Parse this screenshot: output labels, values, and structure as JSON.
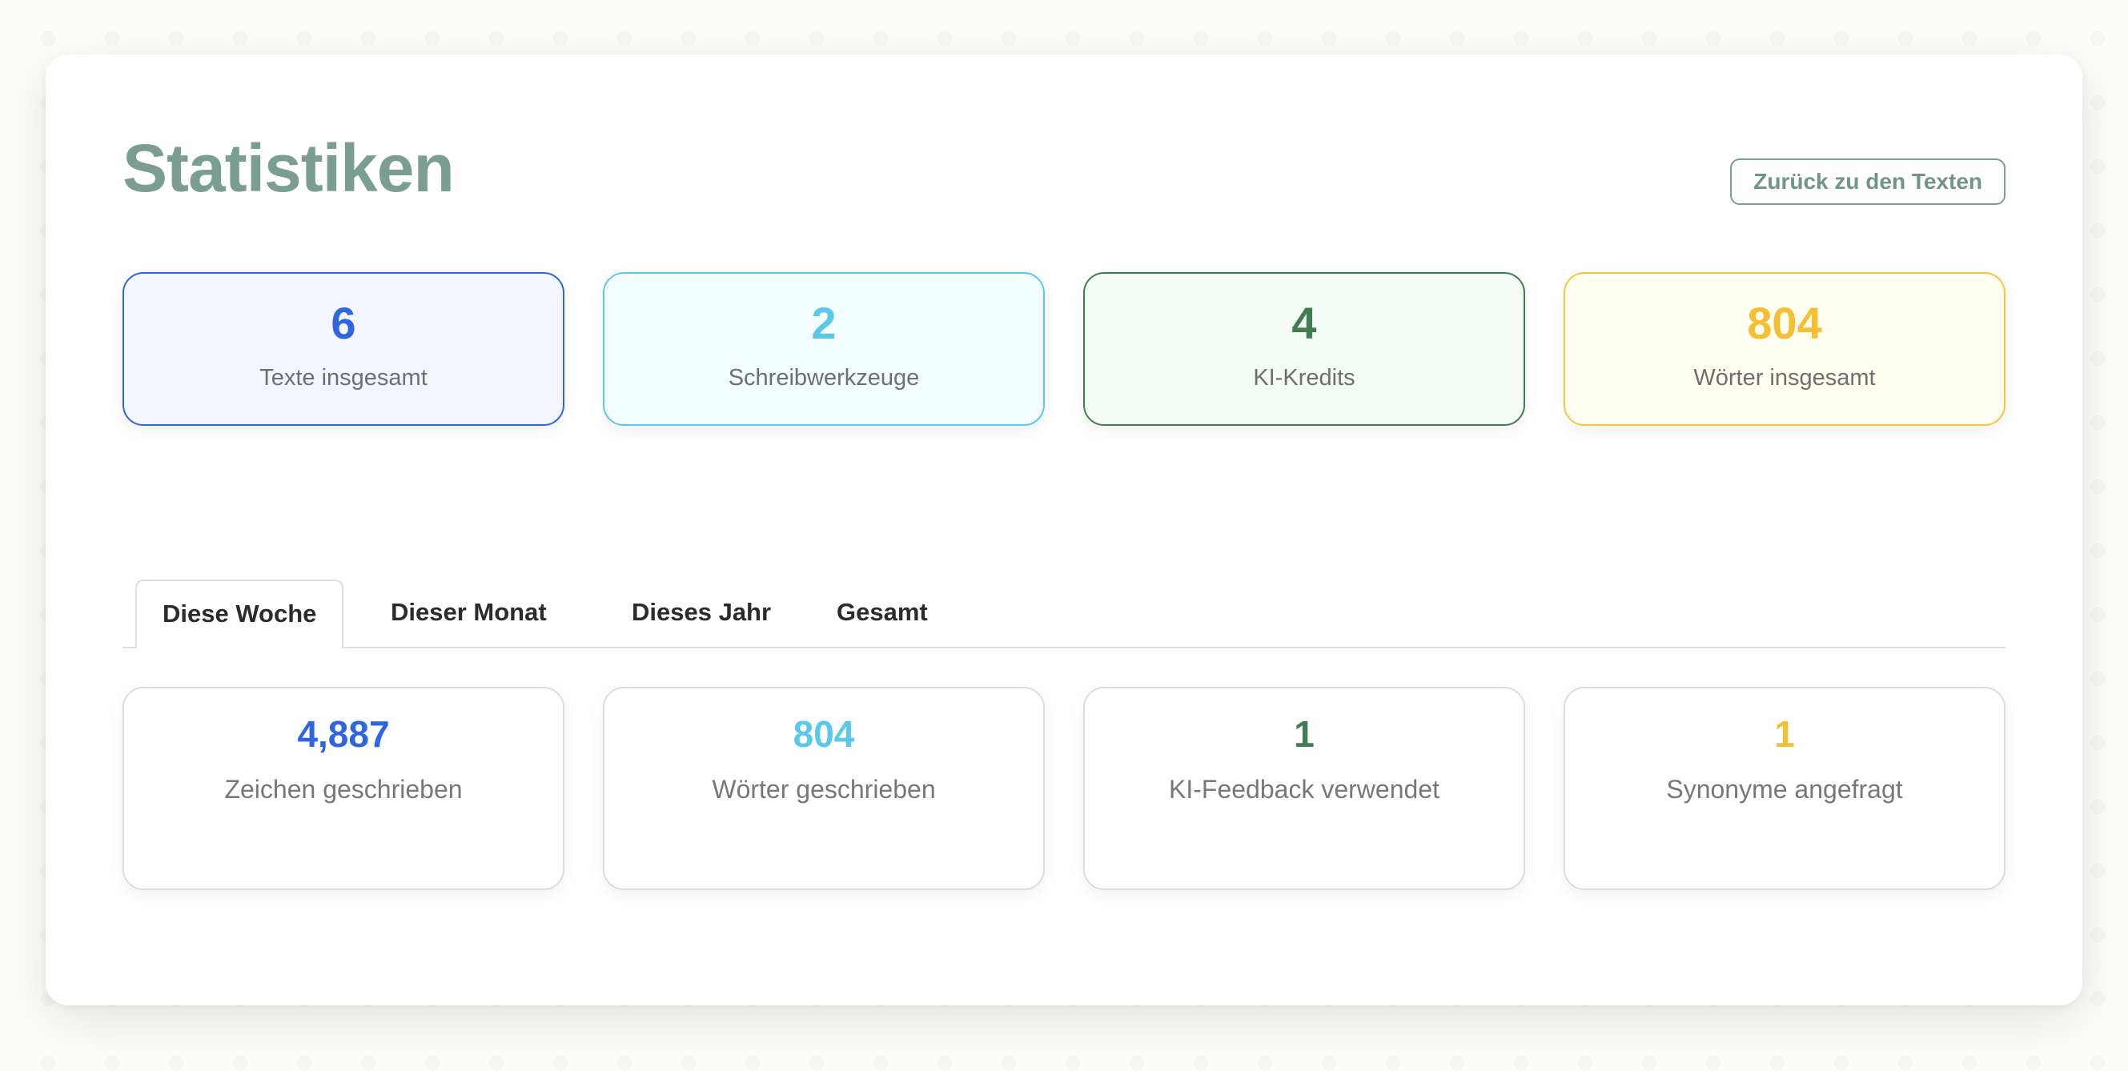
{
  "header": {
    "title": "Statistiken",
    "back_label": "Zurück zu den Texten"
  },
  "stats": [
    {
      "value": "6",
      "label": "Texte insgesamt",
      "color": "#2f66e0"
    },
    {
      "value": "2",
      "label": "Schreibwerkzeuge",
      "color": "#5ac8e8"
    },
    {
      "value": "4",
      "label": "KI-Kredits",
      "color": "#3f7d53"
    },
    {
      "value": "804",
      "label": "Wörter insgesamt",
      "color": "#f5bf33"
    }
  ],
  "tabs": [
    {
      "label": "Diese Woche",
      "active": true
    },
    {
      "label": "Dieser Monat",
      "active": false
    },
    {
      "label": "Dieses Jahr",
      "active": false
    },
    {
      "label": "Gesamt",
      "active": false
    }
  ],
  "period_stats": [
    {
      "value": "4,887",
      "label": "Zeichen geschrieben",
      "color": "#2f66e0"
    },
    {
      "value": "804",
      "label": "Wörter geschrieben",
      "color": "#5ac8e8"
    },
    {
      "value": "1",
      "label": "KI-Feedback verwendet",
      "color": "#3f7d53"
    },
    {
      "value": "1",
      "label": "Synonyme angefragt",
      "color": "#f5bf33"
    }
  ]
}
